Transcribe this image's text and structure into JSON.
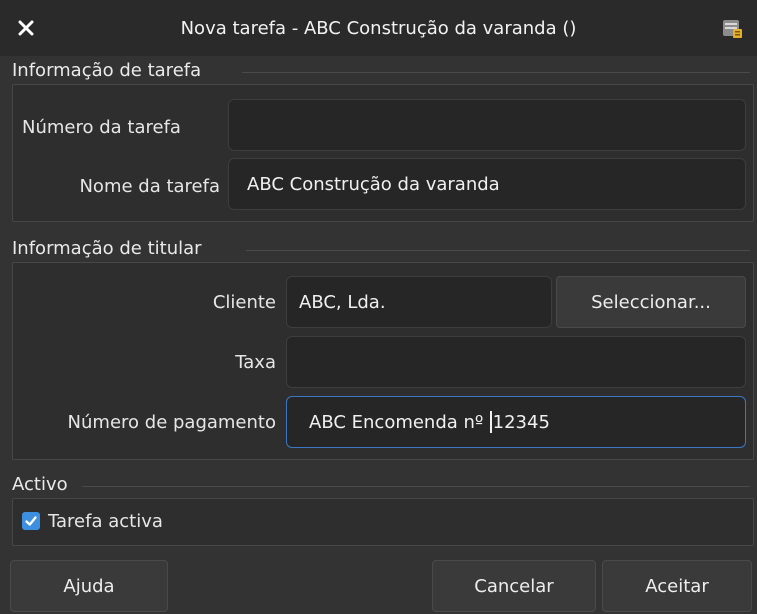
{
  "window": {
    "title": "Nova tarefa - ABC Construção da varanda ()",
    "close_icon": "close-icon",
    "app_icon": "app-icon"
  },
  "task_info": {
    "group_label": "Informação de tarefa",
    "number_label": "Número da tarefa",
    "number_value": "",
    "name_label": "Nome da tarefa",
    "name_value": "ABC Construção da varanda"
  },
  "owner_info": {
    "group_label": "Informação de titular",
    "client_label": "Cliente",
    "client_value": "ABC, Lda.",
    "select_label": "Seleccionar...",
    "rate_label": "Taxa",
    "rate_value": "",
    "payment_label": "Número de pagamento",
    "payment_value_before_caret": "ABC Encomenda nº ",
    "payment_value_after_caret": "12345"
  },
  "active": {
    "group_label": "Activo",
    "checkbox_label": "Tarefa activa",
    "checked": true
  },
  "buttons": {
    "help": "Ajuda",
    "cancel": "Cancelar",
    "accept": "Aceitar"
  },
  "colors": {
    "accent": "#3b77c4",
    "checkbox": "#3d8fe0",
    "background": "#333333"
  }
}
